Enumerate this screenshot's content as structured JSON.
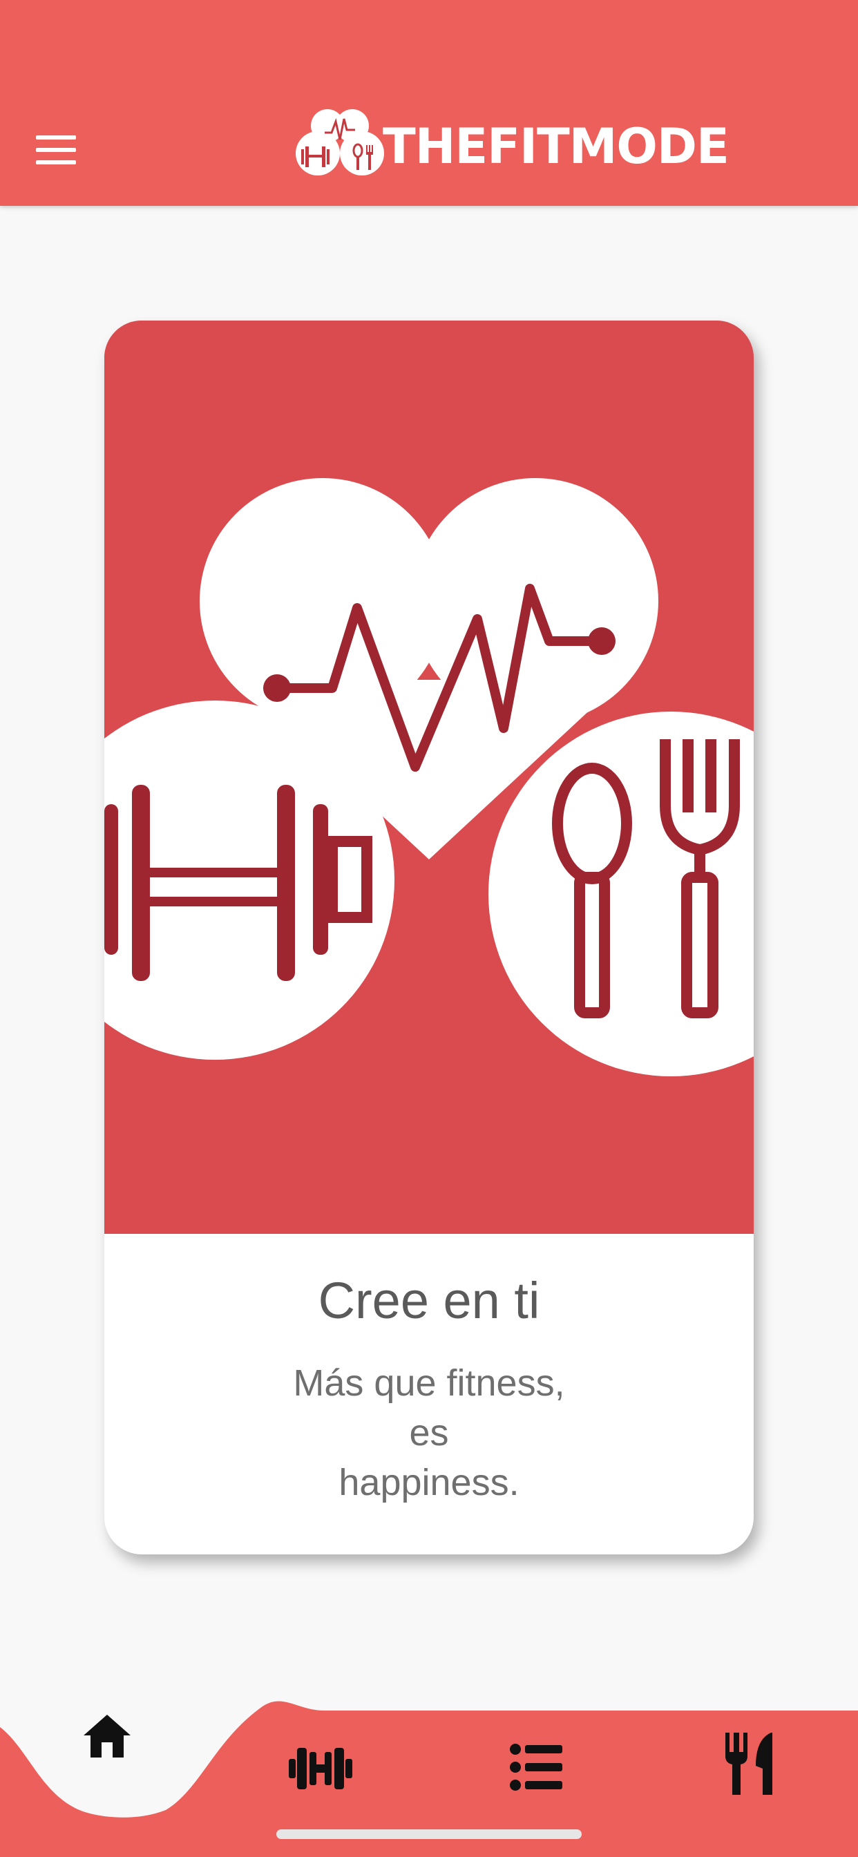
{
  "header": {
    "brand_name": "THEFITMODE",
    "menu_icon": "hamburger-menu-icon",
    "background_color": "#ed5f5a"
  },
  "card": {
    "title": "Cree en ti",
    "subtitle_lines": [
      "Más que fitness,",
      "es",
      "happiness."
    ],
    "image_icons": [
      "heart-pulse-icon",
      "dumbbell-icon",
      "spoon-fork-icon"
    ],
    "image_background_color": "#d94b4f",
    "icon_color": "#9e2631"
  },
  "bottom_nav": {
    "items": [
      {
        "icon": "home-icon",
        "active": true
      },
      {
        "icon": "dumbbell-icon",
        "active": false
      },
      {
        "icon": "list-icon",
        "active": false
      },
      {
        "icon": "utensils-icon",
        "active": false
      }
    ],
    "background_color": "#ed5f5a"
  }
}
